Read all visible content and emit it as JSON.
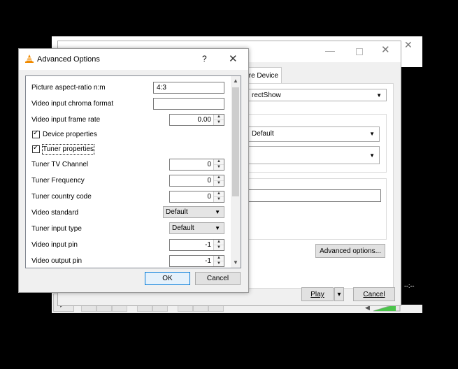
{
  "vlc_back": {
    "time": "--:--"
  },
  "open_media": {
    "tab_capture_device": "re Device",
    "capture_mode": "rectShow",
    "video_device": "Default",
    "audio_device": "",
    "options_value": "",
    "advanced_options_button": "Advanced options...",
    "play_button": "Play",
    "cancel_button": "Cancel"
  },
  "advanced": {
    "title": "Advanced Options",
    "help": "?",
    "close": "✕",
    "rows": {
      "aspect_label": "Picture aspect-ratio n:m",
      "aspect_value": "4:3",
      "chroma_label": "Video input chroma format",
      "chroma_value": "",
      "framerate_label": "Video input frame rate",
      "framerate_value": "0.00",
      "device_props_label": "Device properties",
      "tuner_props_label": "Tuner properties",
      "tv_channel_label": "Tuner TV Channel",
      "tv_channel_value": "0",
      "frequency_label": "Tuner Frequency",
      "frequency_value": "0",
      "country_label": "Tuner country code",
      "country_value": "0",
      "video_standard_label": "Video standard",
      "video_standard_value": "Default",
      "tuner_input_label": "Tuner input type",
      "tuner_input_value": "Default",
      "input_pin_label": "Video input pin",
      "input_pin_value": "-1",
      "output_pin_label": "Video output pin",
      "output_pin_value": "-1"
    },
    "device_props_checked": true,
    "tuner_props_checked": true,
    "ok_button": "OK",
    "cancel_button": "Cancel"
  },
  "colors": {
    "accent": "#0078d7",
    "vlc_orange": "#f08a00"
  }
}
